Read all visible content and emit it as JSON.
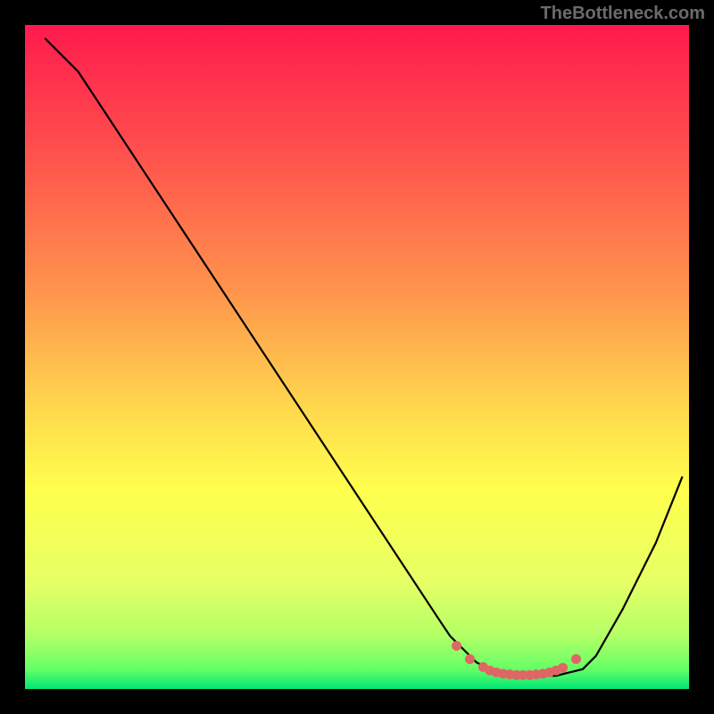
{
  "watermark": "TheBottleneck.com",
  "chart_data": {
    "type": "line",
    "title": "",
    "xlabel": "",
    "ylabel": "",
    "xlim": [
      0,
      100
    ],
    "ylim": [
      0,
      100
    ],
    "gradient_stops": [
      {
        "offset": 0,
        "color": "#ff1a4d"
      },
      {
        "offset": 18,
        "color": "#ff4d4d"
      },
      {
        "offset": 40,
        "color": "#ff944d"
      },
      {
        "offset": 58,
        "color": "#ffd94d"
      },
      {
        "offset": 70,
        "color": "#ffff4d"
      },
      {
        "offset": 84,
        "color": "#e6ff66"
      },
      {
        "offset": 92,
        "color": "#b3ff66"
      },
      {
        "offset": 97,
        "color": "#66ff66"
      },
      {
        "offset": 100,
        "color": "#00e673"
      }
    ],
    "series": [
      {
        "name": "curve",
        "x": [
          3,
          5,
          8,
          62,
          64,
          66,
          68,
          70,
          72,
          74,
          76,
          78,
          80,
          82,
          84,
          86,
          90,
          95,
          99
        ],
        "values": [
          98,
          96,
          93,
          11,
          8,
          6,
          4,
          3,
          2.5,
          2,
          2,
          2,
          2,
          2.5,
          3,
          5,
          12,
          22,
          32
        ]
      }
    ],
    "markers": {
      "name": "highlight-points",
      "color": "#e06666",
      "x": [
        65,
        67,
        69,
        70,
        71,
        72,
        73,
        74,
        75,
        76,
        77,
        78,
        79,
        80,
        81,
        83
      ],
      "values": [
        6.5,
        4.5,
        3.3,
        2.8,
        2.5,
        2.3,
        2.2,
        2.1,
        2.1,
        2.1,
        2.2,
        2.3,
        2.5,
        2.8,
        3.2,
        4.5
      ]
    }
  }
}
